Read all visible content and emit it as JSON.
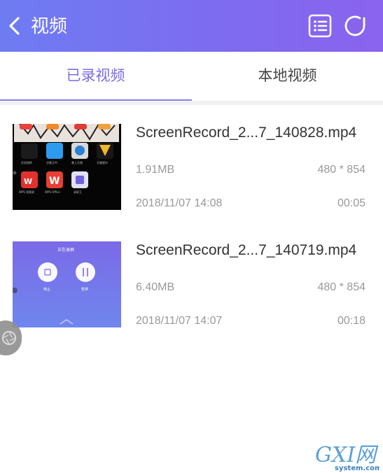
{
  "header": {
    "title": "视频",
    "back_icon": "chevron-left-icon",
    "list_icon": "list-view-icon",
    "refresh_icon": "refresh-icon",
    "gradient": [
      "#6e7cf2",
      "#8a63ee"
    ]
  },
  "tabs": [
    {
      "label": "已录视频",
      "active": true
    },
    {
      "label": "本地视频",
      "active": false
    }
  ],
  "accent_color": "#7b6de9",
  "videos": [
    {
      "filename": "ScreenRecord_2...7_140828.mp4",
      "size": "1.91MB",
      "resolution": "480 * 854",
      "date": "2018/11/07 14:08",
      "duration": "00:05",
      "thumb_labels": [
        "任务指挥",
        "谷歌汉书",
        "掌上天使",
        "天猫超市",
        "WPS 投影屏",
        "WPS Office",
        "录屏王"
      ]
    },
    {
      "filename": "ScreenRecord_2...7_140719.mp4",
      "size": "6.40MB",
      "resolution": "480 * 854",
      "date": "2018/11/07 14:07",
      "duration": "00:18",
      "thumb_labels": [
        "正在录屏",
        "停止",
        "暂停"
      ]
    }
  ],
  "floating_button_icon": "aperture-icon",
  "watermark": {
    "main": "GXI网",
    "sub": "system.com"
  }
}
